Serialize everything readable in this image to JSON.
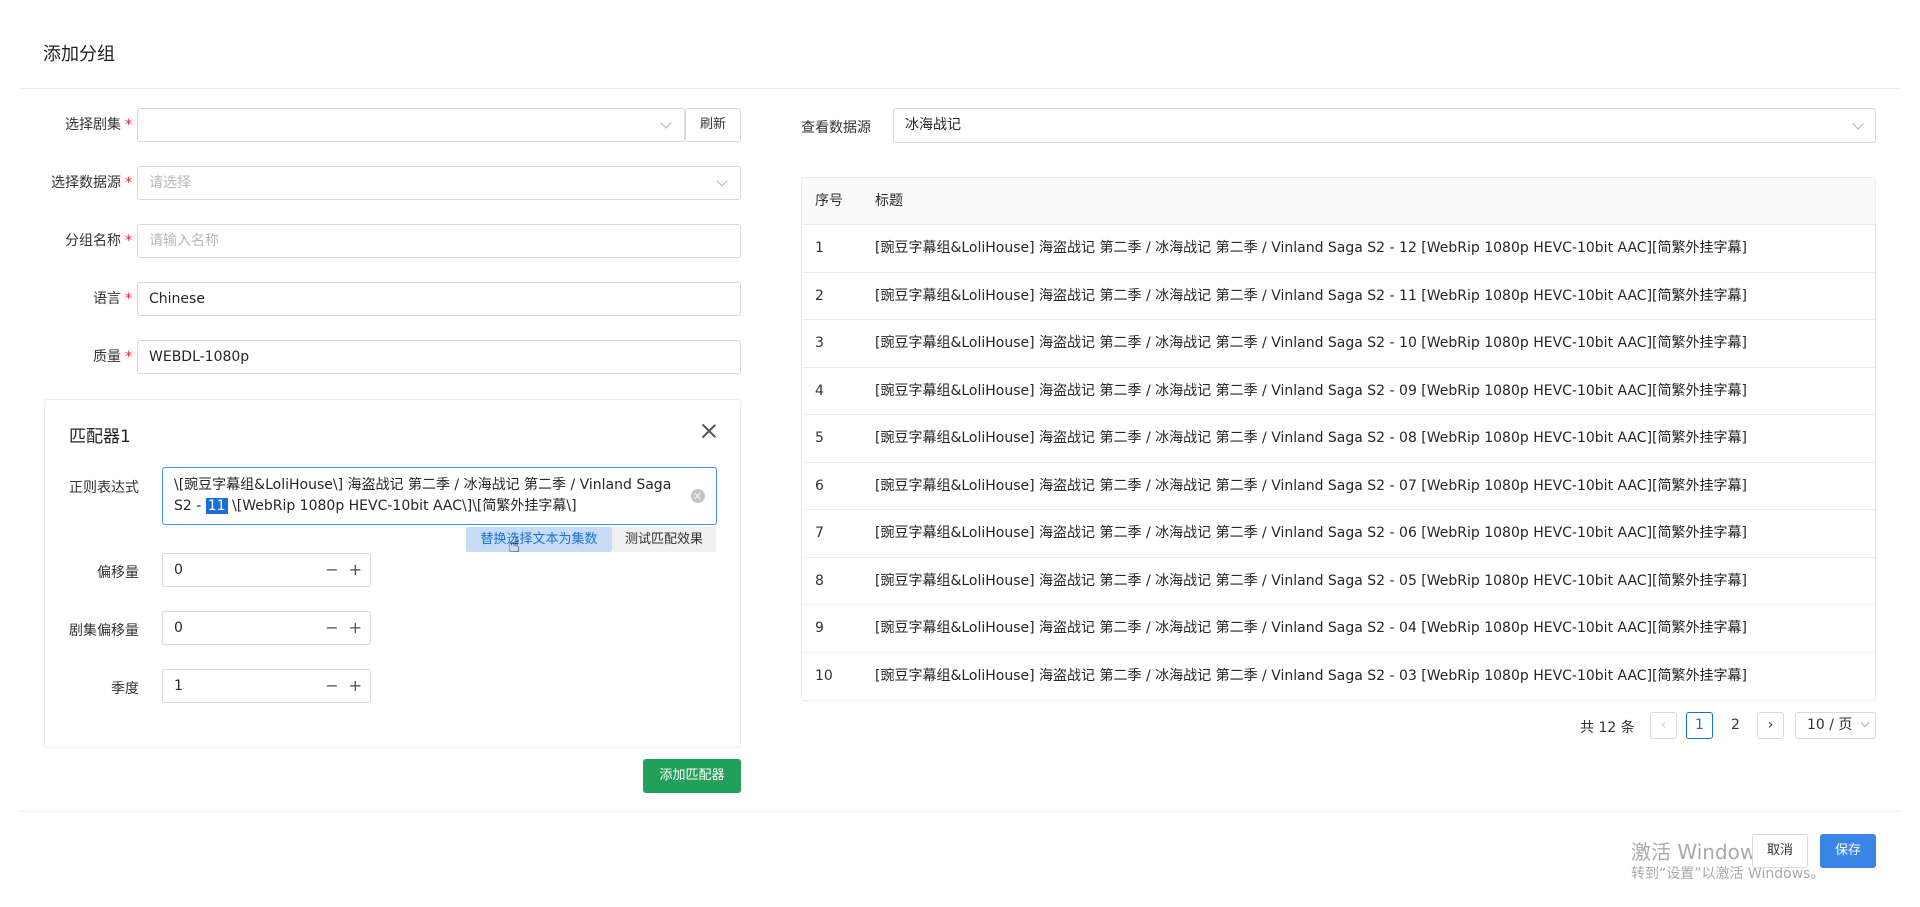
{
  "modal": {
    "title": "添加分组"
  },
  "form": {
    "series": {
      "label": "选择剧集",
      "value": "",
      "refresh_label": "刷新"
    },
    "datasource": {
      "label": "选择数据源",
      "placeholder": "请选择"
    },
    "group_name": {
      "label": "分组名称",
      "placeholder": "请输入名称"
    },
    "language": {
      "label": "语言",
      "value": "Chinese"
    },
    "quality": {
      "label": "质量",
      "value": "WEBDL-1080p"
    },
    "required_mark": "*"
  },
  "matcher": {
    "title": "匹配器1",
    "regex_label": "正则表达式",
    "regex_before": "\\[豌豆字幕组&LoliHouse\\] 海盗战记 第二季 / 冰海战记 第二季 / Vinland Saga S2 - ",
    "regex_selected": "11",
    "regex_after": " \\[WebRip 1080p HEVC-10bit AAC\\]\\[简繁外挂字幕\\]",
    "replace_label": "替换选择文本为集数",
    "test_label": "测试匹配效果",
    "offset": {
      "label": "偏移量",
      "value": "0"
    },
    "series_offset": {
      "label": "剧集偏移量",
      "value": "0"
    },
    "season": {
      "label": "季度",
      "value": "1"
    },
    "minus": "−",
    "plus": "+",
    "add_label": "添加匹配器"
  },
  "viewer": {
    "label": "查看数据源",
    "value": "冰海战记",
    "columns": [
      "序号",
      "标题"
    ],
    "rows": [
      {
        "no": "1",
        "title": "[豌豆字幕组&LoliHouse] 海盗战记 第二季 / 冰海战记 第二季 / Vinland Saga S2 - 12 [WebRip 1080p HEVC-10bit AAC][简繁外挂字幕]"
      },
      {
        "no": "2",
        "title": "[豌豆字幕组&LoliHouse] 海盗战记 第二季 / 冰海战记 第二季 / Vinland Saga S2 - 11 [WebRip 1080p HEVC-10bit AAC][简繁外挂字幕]"
      },
      {
        "no": "3",
        "title": "[豌豆字幕组&LoliHouse] 海盗战记 第二季 / 冰海战记 第二季 / Vinland Saga S2 - 10 [WebRip 1080p HEVC-10bit AAC][简繁外挂字幕]"
      },
      {
        "no": "4",
        "title": "[豌豆字幕组&LoliHouse] 海盗战记 第二季 / 冰海战记 第二季 / Vinland Saga S2 - 09 [WebRip 1080p HEVC-10bit AAC][简繁外挂字幕]"
      },
      {
        "no": "5",
        "title": "[豌豆字幕组&LoliHouse] 海盗战记 第二季 / 冰海战记 第二季 / Vinland Saga S2 - 08 [WebRip 1080p HEVC-10bit AAC][简繁外挂字幕]"
      },
      {
        "no": "6",
        "title": "[豌豆字幕组&LoliHouse] 海盗战记 第二季 / 冰海战记 第二季 / Vinland Saga S2 - 07 [WebRip 1080p HEVC-10bit AAC][简繁外挂字幕]"
      },
      {
        "no": "7",
        "title": "[豌豆字幕组&LoliHouse] 海盗战记 第二季 / 冰海战记 第二季 / Vinland Saga S2 - 06 [WebRip 1080p HEVC-10bit AAC][简繁外挂字幕]"
      },
      {
        "no": "8",
        "title": "[豌豆字幕组&LoliHouse] 海盗战记 第二季 / 冰海战记 第二季 / Vinland Saga S2 - 05 [WebRip 1080p HEVC-10bit AAC][简繁外挂字幕]"
      },
      {
        "no": "9",
        "title": "[豌豆字幕组&LoliHouse] 海盗战记 第二季 / 冰海战记 第二季 / Vinland Saga S2 - 04 [WebRip 1080p HEVC-10bit AAC][简繁外挂字幕]"
      },
      {
        "no": "10",
        "title": "[豌豆字幕组&LoliHouse] 海盗战记 第二季 / 冰海战记 第二季 / Vinland Saga S2 - 03 [WebRip 1080p HEVC-10bit AAC][简繁外挂字幕]"
      }
    ]
  },
  "pagination": {
    "total": "共 12 条",
    "prev": "‹",
    "pages": [
      "1",
      "2"
    ],
    "next": "›",
    "page_size": "10 / 页"
  },
  "footer": {
    "cancel_label": "取消",
    "save_label": "保存"
  },
  "watermark": {
    "line1": "激活 Windows",
    "line2": "转到“设置”以激活 Windows。"
  },
  "colors": {
    "primary": "#3a86e8",
    "success": "#22a05a",
    "required": "#f5222d",
    "selection": "#1a6fd6"
  }
}
